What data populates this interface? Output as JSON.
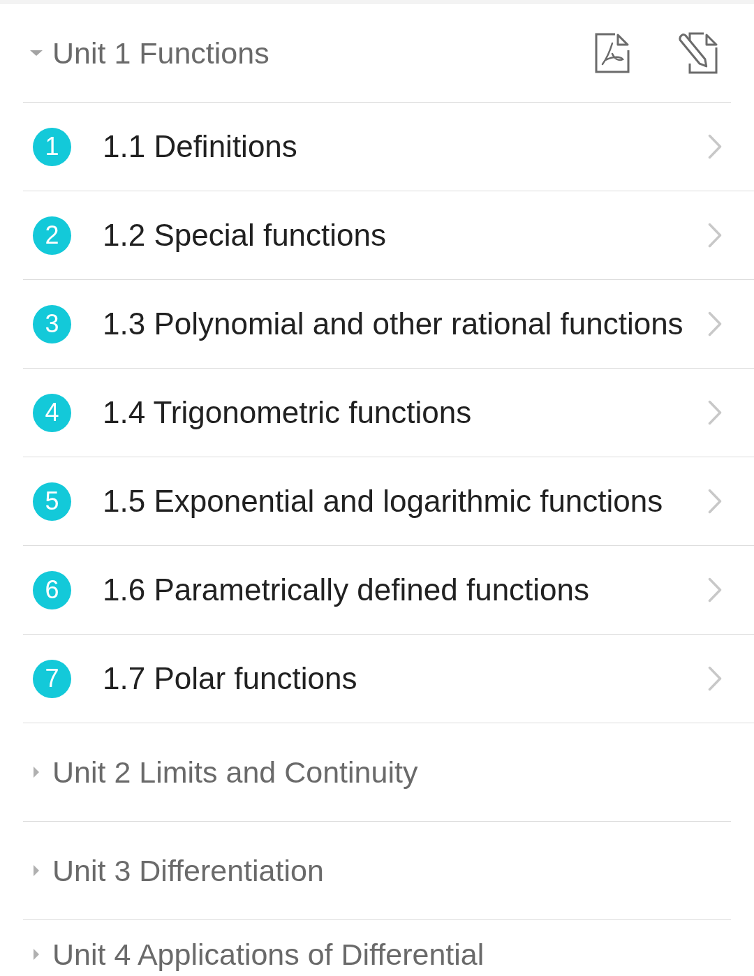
{
  "units": [
    {
      "title": "Unit 1 Functions",
      "expanded": true,
      "lessons": [
        {
          "number": "1",
          "title": "1.1 Definitions"
        },
        {
          "number": "2",
          "title": "1.2 Special functions"
        },
        {
          "number": "3",
          "title": "1.3 Polynomial and other rational functions"
        },
        {
          "number": "4",
          "title": "1.4 Trigonometric functions"
        },
        {
          "number": "5",
          "title": "1.5 Exponential and logarithmic functions"
        },
        {
          "number": "6",
          "title": "1.6 Parametrically defined functions"
        },
        {
          "number": "7",
          "title": "1.7 Polar functions"
        }
      ]
    },
    {
      "title": "Unit 2 Limits and Continuity",
      "expanded": false
    },
    {
      "title": "Unit 3 Differentiation",
      "expanded": false
    },
    {
      "title": "Unit 4 Applications of Differential",
      "expanded": false
    }
  ]
}
